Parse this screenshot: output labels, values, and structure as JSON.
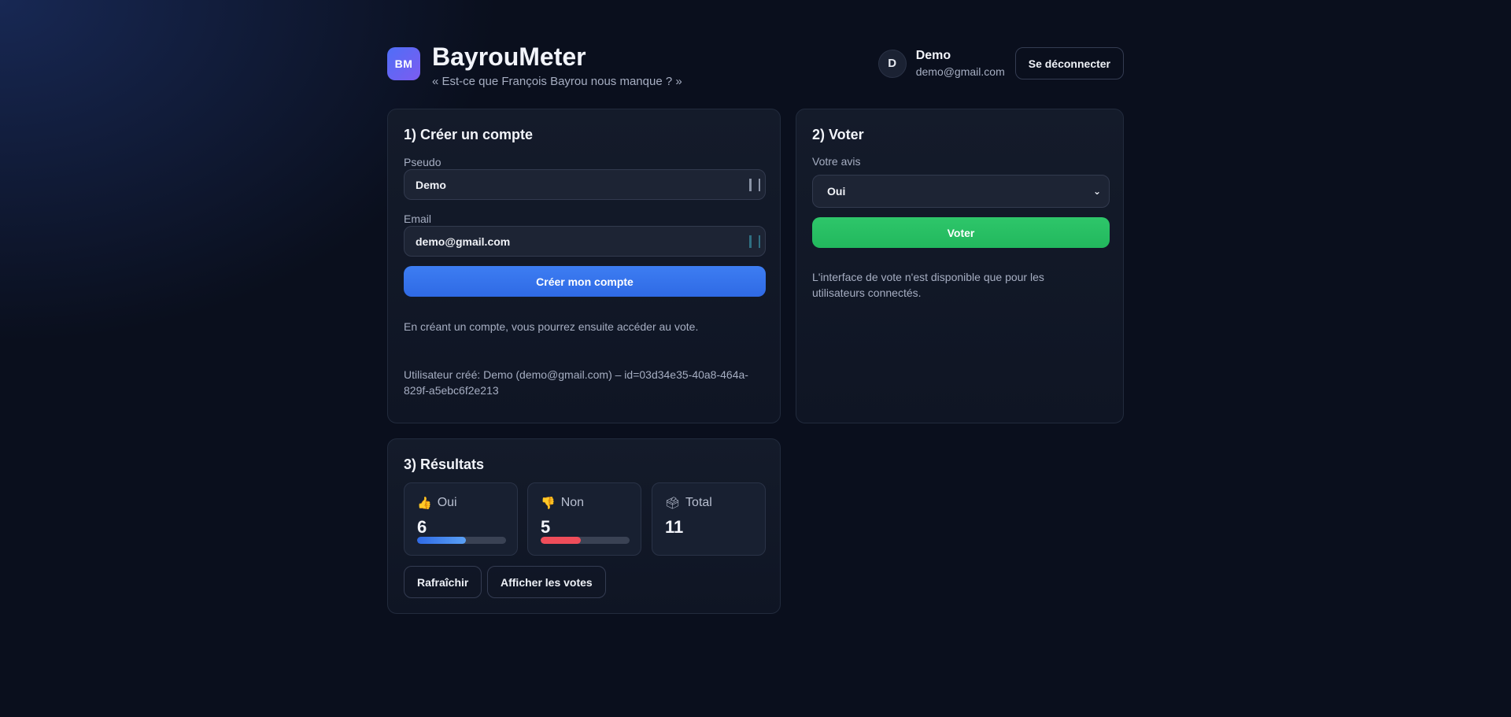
{
  "header": {
    "logo_text": "BM",
    "title": "BayrouMeter",
    "subtitle": "« Est-ce que François Bayrou nous manque ? »",
    "user": {
      "avatar_letter": "D",
      "name": "Demo",
      "email": "demo@gmail.com"
    },
    "logout_label": "Se déconnecter"
  },
  "create_account": {
    "title": "1) Créer un compte",
    "pseudo_label": "Pseudo",
    "pseudo_value": "Demo",
    "email_label": "Email",
    "email_value": "demo@gmail.com",
    "submit_label": "Créer mon compte",
    "help_text": "En créant un compte, vous pourrez ensuite accéder au vote.",
    "status_text": "Utilisateur créé: Demo (demo@gmail.com) – id=03d34e35-40a8-464a-829f-a5ebc6f2e213"
  },
  "vote": {
    "title": "2) Voter",
    "opinion_label": "Votre avis",
    "selected_option": "Oui",
    "submit_label": "Voter",
    "info_text": "L'interface de vote n'est disponible que pour les utilisateurs connectés."
  },
  "results": {
    "title": "3) Résultats",
    "yes": {
      "icon": "thumbs-up-icon",
      "glyph": "👍",
      "label": "Oui",
      "value": "6",
      "fraction": 0.5454
    },
    "no": {
      "icon": "thumbs-down-icon",
      "glyph": "👎",
      "label": "Non",
      "value": "5",
      "fraction": 0.4545
    },
    "total": {
      "icon": "ballot-box-icon",
      "glyph": "🗳",
      "label": "Total",
      "value": "11"
    },
    "refresh_label": "Rafraîchir",
    "show_votes_label": "Afficher les votes"
  },
  "colors": {
    "accent_blue": "#3d7df2",
    "accent_green": "#2ec66a",
    "no_red": "#ef4d5a",
    "yes_bar_start": "#2f6ae5",
    "yes_bar_end": "#5aa0f5"
  }
}
